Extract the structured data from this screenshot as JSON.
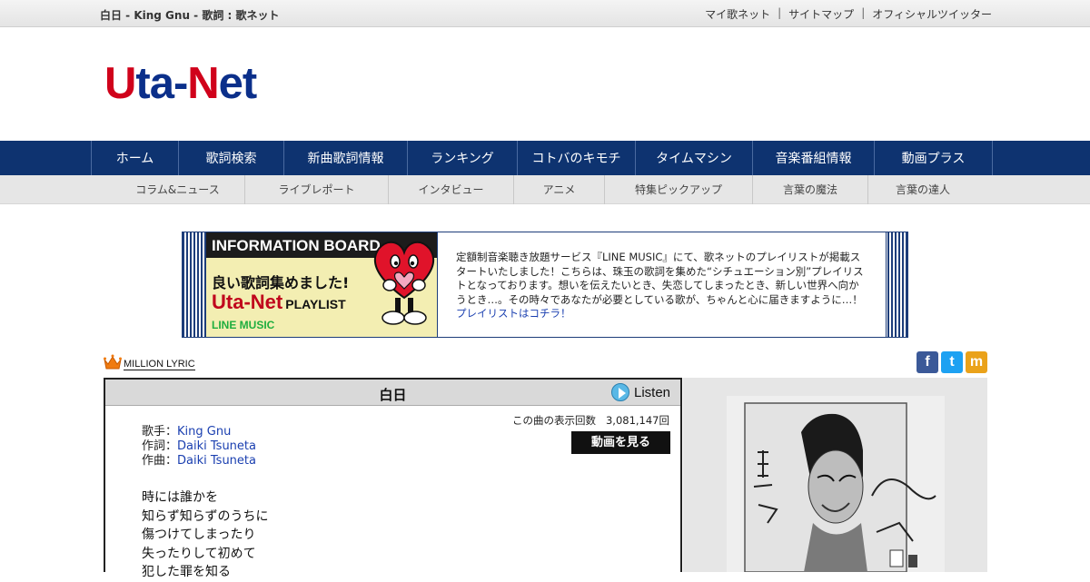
{
  "header": {
    "page_title": "白日 - King Gnu - 歌詞 : 歌ネット",
    "links": [
      "マイ歌ネット",
      "サイトマップ",
      "オフィシャルツイッター"
    ],
    "separator": "|"
  },
  "logo": {
    "part1": "U",
    "part2": "ta-",
    "part3": "N",
    "part4": "et"
  },
  "main_nav": [
    "ホーム",
    "歌詞検索",
    "新曲歌詞情報",
    "ランキング",
    "コトバのキモチ",
    "タイムマシン",
    "音楽番組情報",
    "動画プラス"
  ],
  "sub_nav": [
    "コラム&ニュース",
    "ライブレポート",
    "インタビュー",
    "アニメ",
    "特集ピックアップ",
    "言葉の魔法",
    "言葉の達人"
  ],
  "info_board": {
    "banner_head": "INFORMATION BOARD",
    "banner_line1": "良い歌詞集めました!",
    "banner_line2": "Uta-Net",
    "banner_line2b": "PLAYLIST",
    "banner_line3": "LINE MUSIC",
    "text": "定額制音楽聴き放題サービス『LINE MUSIC』にて、歌ネットのプレイリストが掲載スタートいたしました！こちらは、珠玉の歌詞を集めた“シチュエーション別”プレイリストとなっております。想いを伝えたいとき、失恋してしまったとき、新しい世界へ向かうとき…。その時々であなたが必要としている歌が、ちゃんと心に届きますように…！",
    "link": "プレイリストはコチラ！"
  },
  "million_lyric": {
    "label": "MILLION LYRIC"
  },
  "social": {
    "facebook": "f",
    "twitter": "t",
    "mixi": "m"
  },
  "song": {
    "title": "白日",
    "listen": "Listen",
    "view_count_label": "この曲の表示回数",
    "view_count": "3,081,147回",
    "video_button": "動画を見る",
    "artist_label": "歌手：",
    "artist": "King Gnu",
    "lyricist_label": "作詞：",
    "lyricist": "Daiki Tsuneta",
    "composer_label": "作曲：",
    "composer": "Daiki Tsuneta",
    "lyrics": [
      "時には誰かを",
      "知らず知らずのうちに",
      "傷つけてしまったり",
      "失ったりして初めて",
      "犯した罪を知る"
    ]
  },
  "colors": {
    "nav": "#0e3370",
    "logo_red": "#d0021b",
    "logo_blue": "#0b2f8a",
    "link": "#1a3fb0"
  }
}
